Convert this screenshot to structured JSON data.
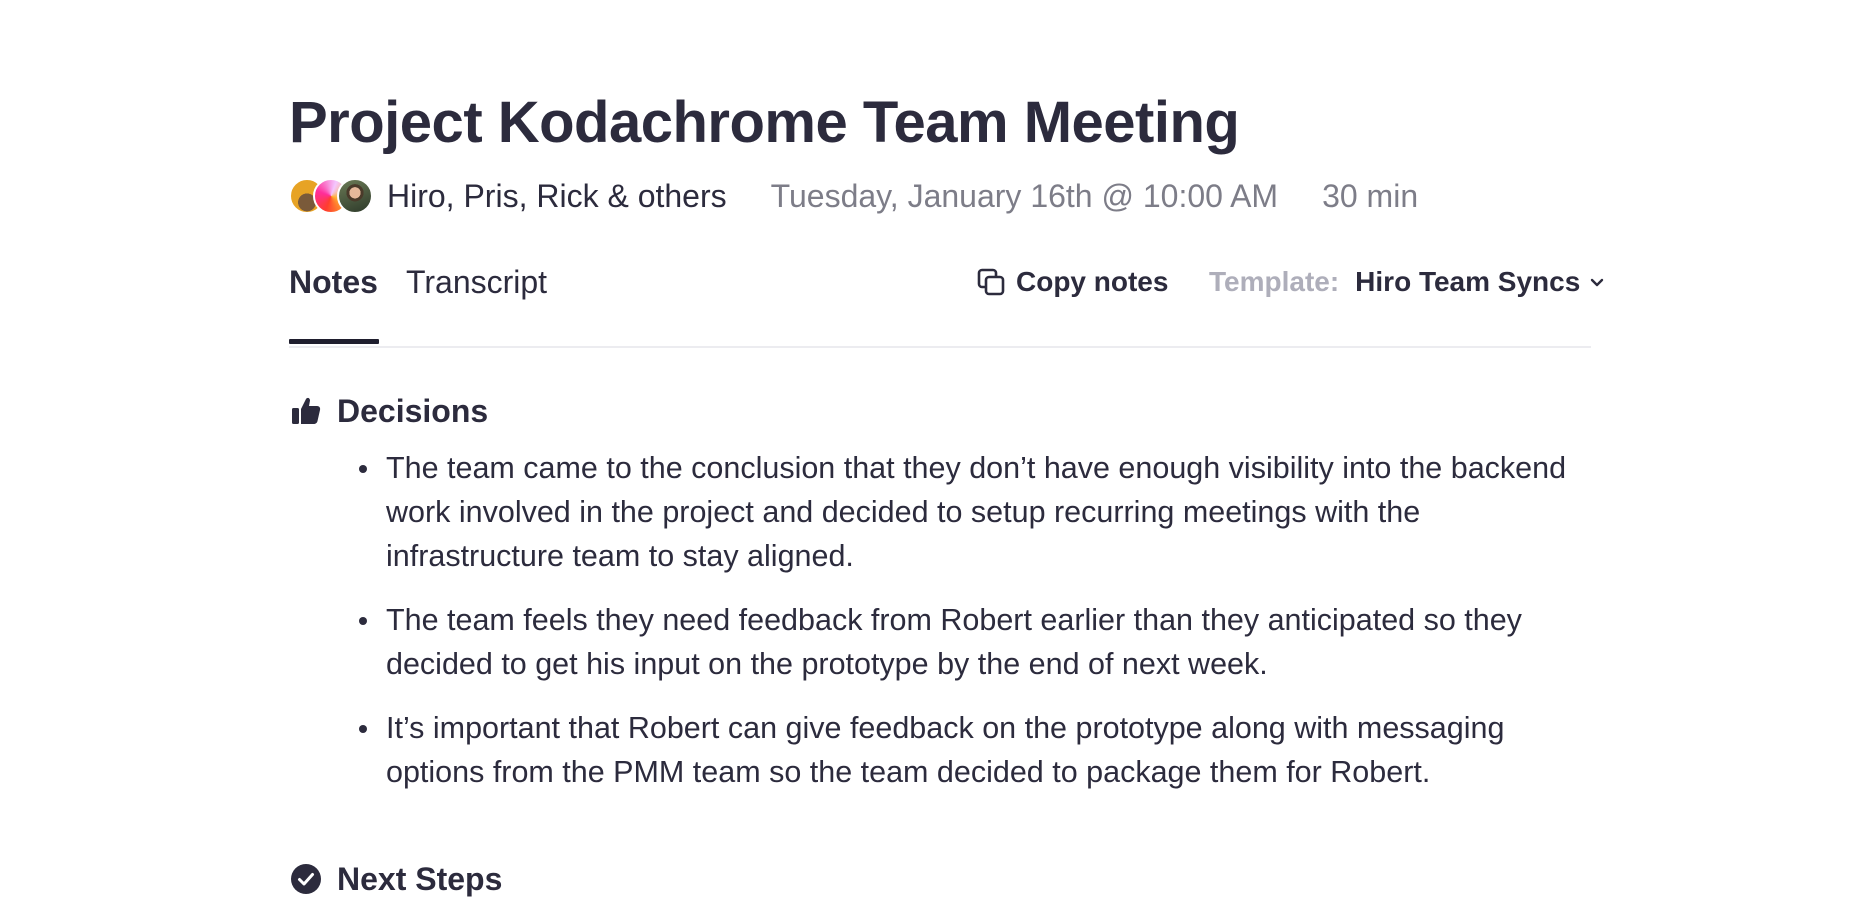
{
  "meeting": {
    "title": "Project Kodachrome Team Meeting",
    "attendees_label": "Hiro, Pris, Rick & others",
    "date": "Tuesday, January 16th @ 10:00 AM",
    "duration": "30 min",
    "avatars": [
      "avatar-hiro",
      "avatar-pris",
      "avatar-rick"
    ]
  },
  "tabs": [
    {
      "label": "Notes",
      "active": true
    },
    {
      "label": "Transcript",
      "active": false
    }
  ],
  "toolbar": {
    "copy_label": "Copy notes",
    "copy_icon": "copy-icon",
    "template_label": "Template:",
    "template_value": "Hiro Team Syncs",
    "template_icon": "chevron-down-icon"
  },
  "sections": {
    "decisions": {
      "title": "Decisions",
      "icon": "thumbs-up-icon",
      "items": [
        "The team came to the conclusion that they don’t have enough visibility into the backend work involved in the project and decided to setup recurring meetings with the infrastructure team to stay aligned.",
        "The team feels they need feedback from Robert earlier than they anticipated so they decided to get his input on the prototype by the end of next week.",
        "It’s important that Robert can give feedback on the prototype along with messaging options from the PMM team so the team decided to package them for Robert."
      ]
    },
    "next_steps": {
      "title": "Next Steps",
      "icon": "check-circle-icon"
    }
  },
  "colors": {
    "text": "#2c2b3d",
    "muted": "#7d7d88",
    "label": "#aeaeba",
    "divider": "#ececf0"
  }
}
